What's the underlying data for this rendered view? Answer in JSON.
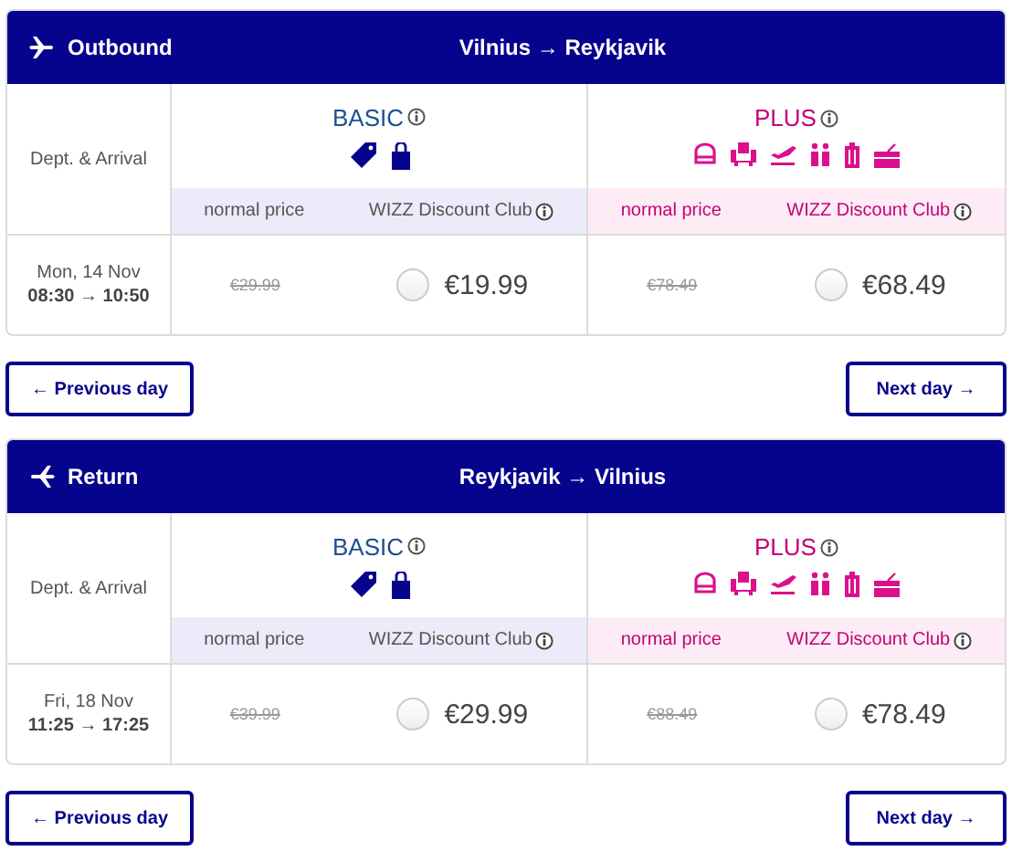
{
  "flights": [
    {
      "kind": "outbound",
      "label": "Outbound",
      "route": "Vilnius → Reykjavik",
      "time_header": "Dept. & Arrival",
      "date": "Mon, 14 Nov",
      "times": "08:30 → 10:50",
      "fares": [
        {
          "kind": "basic",
          "name": "BASIC",
          "normal_label": "normal price",
          "club_label": "WIZZ Discount Club",
          "normal_price": "€29.99",
          "club_price": "€19.99",
          "selected": false
        },
        {
          "kind": "plus",
          "name": "PLUS",
          "normal_label": "normal price",
          "club_label": "WIZZ Discount Club",
          "normal_price": "€78.49",
          "club_price": "€68.49",
          "selected": false
        }
      ],
      "prev_button": "← Previous day",
      "next_button": "Next day →"
    },
    {
      "kind": "return",
      "label": "Return",
      "route": "Reykjavik → Vilnius",
      "time_header": "Dept. & Arrival",
      "date": "Fri, 18 Nov",
      "times": "11:25 → 17:25",
      "fares": [
        {
          "kind": "basic",
          "name": "BASIC",
          "normal_label": "normal price",
          "club_label": "WIZZ Discount Club",
          "normal_price": "€39.99",
          "club_price": "€29.99",
          "selected": false
        },
        {
          "kind": "plus",
          "name": "PLUS",
          "normal_label": "normal price",
          "club_label": "WIZZ Discount Club",
          "normal_price": "€88.49",
          "club_price": "€78.49",
          "selected": false
        }
      ],
      "prev_button": "← Previous day",
      "next_button": "Next day →"
    }
  ]
}
